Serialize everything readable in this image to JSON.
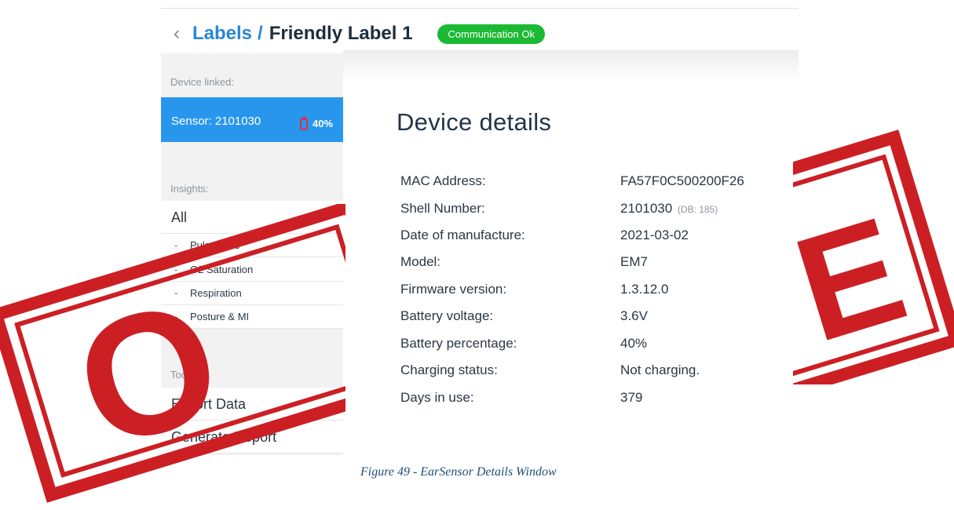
{
  "header": {
    "back_glyph": "‹",
    "breadcrumb_link": "Labels",
    "breadcrumb_separator": "/",
    "breadcrumb_current": "Friendly Label 1",
    "status": "Communication Ok"
  },
  "sidebar": {
    "device_linked_label": "Device linked:",
    "device": {
      "name": "Sensor: 2101030",
      "battery": "40%"
    },
    "insights_label": "Insights:",
    "insights": [
      "All",
      "Pulse Rate",
      "O2 Saturation",
      "Respiration",
      "Posture & MI"
    ],
    "tools_label": "Tools:",
    "tools": [
      "Export Data",
      "Generate Report"
    ]
  },
  "main": {
    "title": "Device details",
    "details": [
      {
        "label": "MAC Address:",
        "value": "FA57F0C500200F26"
      },
      {
        "label": "Shell Number:",
        "value": "2101030",
        "note": "(DB: 185)"
      },
      {
        "label": "Date of manufacture:",
        "value": "2021-03-02"
      },
      {
        "label": "Model:",
        "value": "EM7"
      },
      {
        "label": "Firmware version:",
        "value": "1.3.12.0"
      },
      {
        "label": "Battery voltage:",
        "value": "3.6V"
      },
      {
        "label": "Battery percentage:",
        "value": "40%"
      },
      {
        "label": "Charging status:",
        "value": "Not charging."
      },
      {
        "label": "Days in use:",
        "value": "379"
      }
    ]
  },
  "caption": "Figure 49 - EarSensor Details Window",
  "stamp": {
    "color": "#cc1f24",
    "left_letter": "O",
    "right_letter": "E"
  },
  "colors": {
    "accent": "#2996ee",
    "link": "#2a86d8",
    "status_ok": "#1bb934",
    "battery_low": "#d93048"
  }
}
